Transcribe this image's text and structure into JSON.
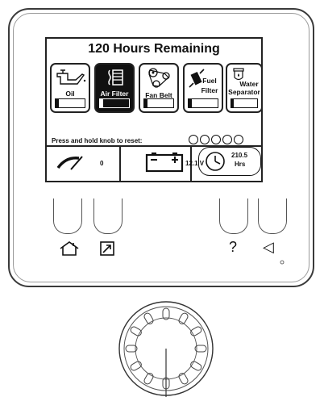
{
  "screen": {
    "title": "120 Hours Remaining",
    "tiles": [
      {
        "label": "Oil",
        "icon": "oil-can-icon",
        "level": 0.1,
        "selected": false
      },
      {
        "label": "Air Filter",
        "icon": "air-filter-icon",
        "level": 0.1,
        "selected": true
      },
      {
        "label": "Fan Belt",
        "icon": "fan-belt-icon",
        "level": 0.1,
        "selected": false
      },
      {
        "label_line1": "Fuel",
        "label_line2": "Filter",
        "icon": "fuel-filter-icon",
        "level": 0.1,
        "selected": false
      },
      {
        "label_line1": "Water",
        "label_line2": "Separator",
        "icon": "water-separator-icon",
        "level": 0.1,
        "selected": false
      }
    ],
    "reset_prompt": "Press and hold knob to reset:",
    "reset_dots": 5,
    "status": {
      "tach_value": "0",
      "battery_value": "12.1 V",
      "hours_value": "210.5",
      "hours_unit": "Hrs"
    }
  },
  "softkeys": [
    {
      "icon": "home-icon"
    },
    {
      "icon": "expand-arrow-icon"
    },
    {
      "icon": "help-icon",
      "glyph": "?"
    },
    {
      "icon": "back-triangle-icon",
      "glyph": "◁"
    }
  ]
}
